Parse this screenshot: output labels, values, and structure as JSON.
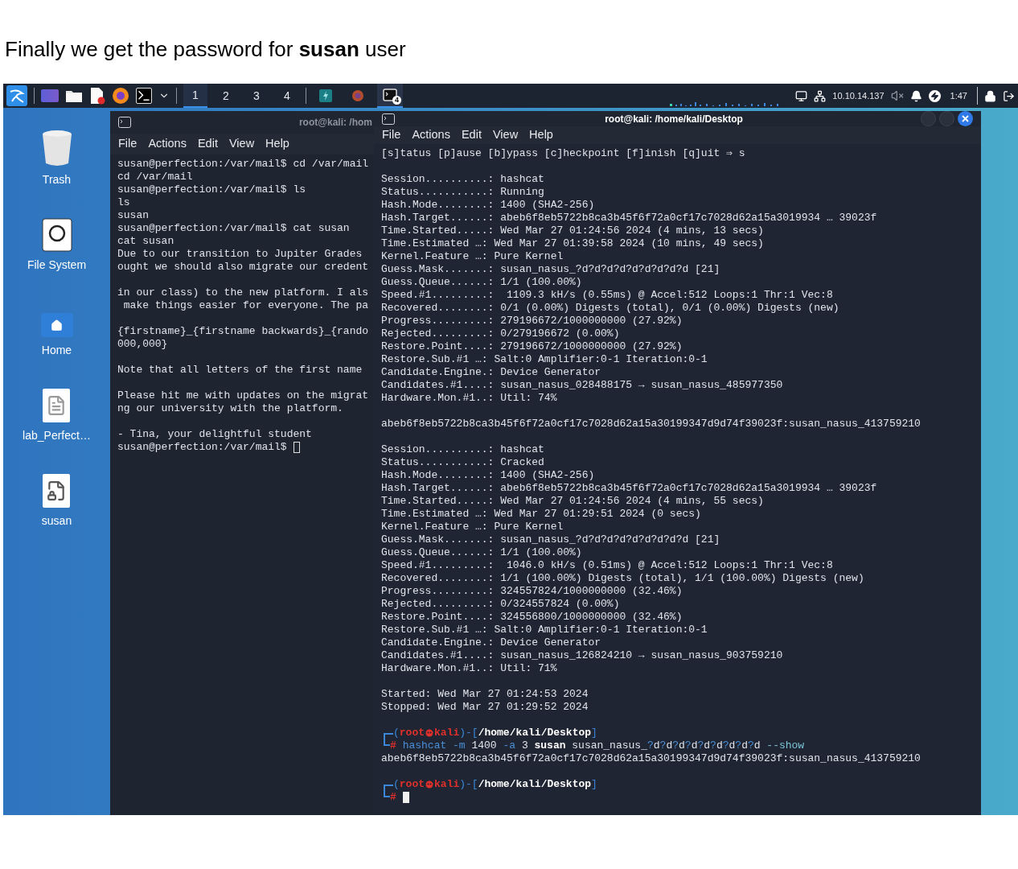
{
  "caption": "Finally we get the password for **susan** user",
  "taskbar": {
    "workspaces": [
      {
        "label": "1",
        "selected": true
      },
      {
        "label": "2",
        "selected": false
      },
      {
        "label": "3",
        "selected": false
      },
      {
        "label": "4",
        "selected": false
      }
    ],
    "apps": [
      {
        "kind": "code",
        "selected": false
      },
      {
        "kind": "browser",
        "selected": false
      },
      {
        "kind": "terminal",
        "selected": true,
        "badge": "4"
      }
    ],
    "ip": "10.10.14.137",
    "time": "1:47"
  },
  "desktop_icons": [
    {
      "kind": "trash",
      "label": "Trash"
    },
    {
      "kind": "drive",
      "label": "File System"
    },
    {
      "kind": "home",
      "label": "Home"
    },
    {
      "kind": "document",
      "label": "lab_Perfect…"
    },
    {
      "kind": "locked-document",
      "label": "susan"
    }
  ],
  "left_terminal": {
    "title": "root@kali: /hom",
    "focused": false,
    "menu": [
      "File",
      "Actions",
      "Edit",
      "View",
      "Help"
    ],
    "blocks": [
      {
        "lines": [
          {
            "text": "susan@perfection:/var/mail$ cd /var/mail"
          },
          {
            "text": "cd /var/mail"
          },
          {
            "text": "susan@perfection:/var/mail$ ls"
          },
          {
            "text": "ls"
          },
          {
            "text": "susan"
          },
          {
            "text": "susan@perfection:/var/mail$ cat susan"
          },
          {
            "text": "cat susan"
          },
          {
            "text": "Due to our transition to Jupiter Grades"
          },
          {
            "text": "ought we should also migrate our credent"
          }
        ]
      },
      {
        "lines": [
          {
            "text": "in our class) to the new platform. I als"
          },
          {
            "text": " make things easier for everyone. The pa"
          }
        ]
      },
      {
        "lines": [
          {
            "text": "{firstname}_{firstname backwards}_{rando"
          },
          {
            "text": "000,000}"
          }
        ]
      },
      {
        "lines": [
          {
            "text": "Note that all letters of the first name"
          }
        ]
      },
      {
        "lines": [
          {
            "text": "Please hit me with updates on the migrat"
          },
          {
            "text": "ng our university with the platform."
          }
        ]
      },
      {
        "lines": [
          {
            "text": "- Tina, your delightful student"
          },
          {
            "text": "susan@perfection:/var/mail$",
            "cursor": true
          }
        ]
      }
    ]
  },
  "right_terminal": {
    "title": "root@kali: /home/kali/Desktop",
    "focused": true,
    "menu": [
      "File",
      "Actions",
      "Edit",
      "View",
      "Help"
    ],
    "blocks": [
      {
        "lines": [
          {
            "kind": "text",
            "text": "[s]tatus [p]ause [b]ypass [c]heckpoint [f]inish [q]uit ⇒ s"
          }
        ]
      },
      {
        "lines": [
          {
            "kind": "text",
            "text": "Session..........: hashcat"
          },
          {
            "kind": "text",
            "text": "Status...........: Running"
          },
          {
            "kind": "text",
            "text": "Hash.Mode........: 1400 (SHA2-256)"
          },
          {
            "kind": "text",
            "text": "Hash.Target......: abeb6f8eb5722b8ca3b45f6f72a0cf17c7028d62a15a3019934 … 39023f"
          },
          {
            "kind": "text",
            "text": "Time.Started.....: Wed Mar 27 01:24:56 2024 (4 mins, 13 secs)"
          },
          {
            "kind": "text",
            "text": "Time.Estimated …: Wed Mar 27 01:39:58 2024 (10 mins, 49 secs)"
          },
          {
            "kind": "text",
            "text": "Kernel.Feature …: Pure Kernel"
          },
          {
            "kind": "text",
            "text": "Guess.Mask.......: susan_nasus_?d?d?d?d?d?d?d?d?d [21]"
          },
          {
            "kind": "text",
            "text": "Guess.Queue......: 1/1 (100.00%)"
          },
          {
            "kind": "text",
            "text": "Speed.#1.........:  1109.3 kH/s (0.55ms) @ Accel:512 Loops:1 Thr:1 Vec:8"
          },
          {
            "kind": "text",
            "text": "Recovered........: 0/1 (0.00%) Digests (total), 0/1 (0.00%) Digests (new)"
          },
          {
            "kind": "text",
            "text": "Progress.........: 279196672/1000000000 (27.92%)"
          },
          {
            "kind": "text",
            "text": "Rejected.........: 0/279196672 (0.00%)"
          },
          {
            "kind": "text",
            "text": "Restore.Point....: 279196672/1000000000 (27.92%)"
          },
          {
            "kind": "text",
            "text": "Restore.Sub.#1 …: Salt:0 Amplifier:0-1 Iteration:0-1"
          },
          {
            "kind": "text",
            "text": "Candidate.Engine.: Device Generator"
          },
          {
            "kind": "text",
            "text": "Candidates.#1....: susan_nasus_028488175 → susan_nasus_485977350"
          },
          {
            "kind": "text",
            "text": "Hardware.Mon.#1..: Util: 74%"
          }
        ]
      },
      {
        "lines": [
          {
            "kind": "text",
            "text": "abeb6f8eb5722b8ca3b45f6f72a0cf17c7028d62a15a30199347d9d74f39023f:susan_nasus_413759210"
          }
        ]
      },
      {
        "lines": [
          {
            "kind": "text",
            "text": "Session..........: hashcat"
          },
          {
            "kind": "text",
            "text": "Status...........: Cracked"
          },
          {
            "kind": "text",
            "text": "Hash.Mode........: 1400 (SHA2-256)"
          },
          {
            "kind": "text",
            "text": "Hash.Target......: abeb6f8eb5722b8ca3b45f6f72a0cf17c7028d62a15a3019934 … 39023f"
          },
          {
            "kind": "text",
            "text": "Time.Started.....: Wed Mar 27 01:24:56 2024 (4 mins, 55 secs)"
          },
          {
            "kind": "text",
            "text": "Time.Estimated …: Wed Mar 27 01:29:51 2024 (0 secs)"
          },
          {
            "kind": "text",
            "text": "Kernel.Feature …: Pure Kernel"
          },
          {
            "kind": "text",
            "text": "Guess.Mask.......: susan_nasus_?d?d?d?d?d?d?d?d?d [21]"
          },
          {
            "kind": "text",
            "text": "Guess.Queue......: 1/1 (100.00%)"
          },
          {
            "kind": "text",
            "text": "Speed.#1.........:  1046.0 kH/s (0.51ms) @ Accel:512 Loops:1 Thr:1 Vec:8"
          },
          {
            "kind": "text",
            "text": "Recovered........: 1/1 (100.00%) Digests (total), 1/1 (100.00%) Digests (new)"
          },
          {
            "kind": "text",
            "text": "Progress.........: 324557824/1000000000 (32.46%)"
          },
          {
            "kind": "text",
            "text": "Rejected.........: 0/324557824 (0.00%)"
          },
          {
            "kind": "text",
            "text": "Restore.Point....: 324556800/1000000000 (32.46%)"
          },
          {
            "kind": "text",
            "text": "Restore.Sub.#1 …: Salt:0 Amplifier:0-1 Iteration:0-1"
          },
          {
            "kind": "text",
            "text": "Candidate.Engine.: Device Generator"
          },
          {
            "kind": "text",
            "text": "Candidates.#1....: susan_nasus_126824210 → susan_nasus_903759210"
          },
          {
            "kind": "text",
            "text": "Hardware.Mon.#1..: Util: 71%"
          }
        ]
      },
      {
        "lines": [
          {
            "kind": "text",
            "text": "Started: Wed Mar 27 01:24:53 2024"
          },
          {
            "kind": "text",
            "text": "Stopped: Wed Mar 27 01:29:52 2024"
          }
        ]
      },
      {
        "lines": [
          {
            "kind": "prompt",
            "open": "(",
            "user": "root",
            "host": "kali",
            "mid": ")-[",
            "path": "/home/kali/Desktop",
            "close": "]"
          },
          {
            "kind": "command",
            "prompt": "#",
            "segments": [
              {
                "text": "hashcat",
                "kind": "cmd"
              },
              {
                "text": " -m ",
                "kind": "flag"
              },
              {
                "text": "1400",
                "kind": "plain"
              },
              {
                "text": " -a ",
                "kind": "flag"
              },
              {
                "text": "3 ",
                "kind": "plain"
              },
              {
                "text": "susan",
                "kind": "bold"
              },
              {
                "text": " susan_nasus_",
                "kind": "plain"
              },
              {
                "text": "?",
                "kind": "flag"
              },
              {
                "text": "d",
                "kind": "plain"
              },
              {
                "text": "?",
                "kind": "flag"
              },
              {
                "text": "d",
                "kind": "plain"
              },
              {
                "text": "?",
                "kind": "flag"
              },
              {
                "text": "d",
                "kind": "plain"
              },
              {
                "text": "?",
                "kind": "flag"
              },
              {
                "text": "d",
                "kind": "plain"
              },
              {
                "text": "?",
                "kind": "flag"
              },
              {
                "text": "d",
                "kind": "plain"
              },
              {
                "text": "?",
                "kind": "flag"
              },
              {
                "text": "d",
                "kind": "plain"
              },
              {
                "text": "?",
                "kind": "flag"
              },
              {
                "text": "d",
                "kind": "plain"
              },
              {
                "text": "?",
                "kind": "flag"
              },
              {
                "text": "d",
                "kind": "plain"
              },
              {
                "text": "?",
                "kind": "flag"
              },
              {
                "text": "d ",
                "kind": "plain"
              },
              {
                "text": "--show",
                "kind": "option"
              }
            ]
          },
          {
            "kind": "text",
            "text": "abeb6f8eb5722b8ca3b45f6f72a0cf17c7028d62a15a30199347d9d74f39023f:susan_nasus_413759210"
          }
        ]
      },
      {
        "lines": [
          {
            "kind": "prompt",
            "open": "(",
            "user": "root",
            "host": "kali",
            "mid": ")-[",
            "path": "/home/kali/Desktop",
            "close": "]"
          },
          {
            "kind": "command",
            "prompt": "#",
            "cursor": true
          }
        ]
      }
    ]
  }
}
